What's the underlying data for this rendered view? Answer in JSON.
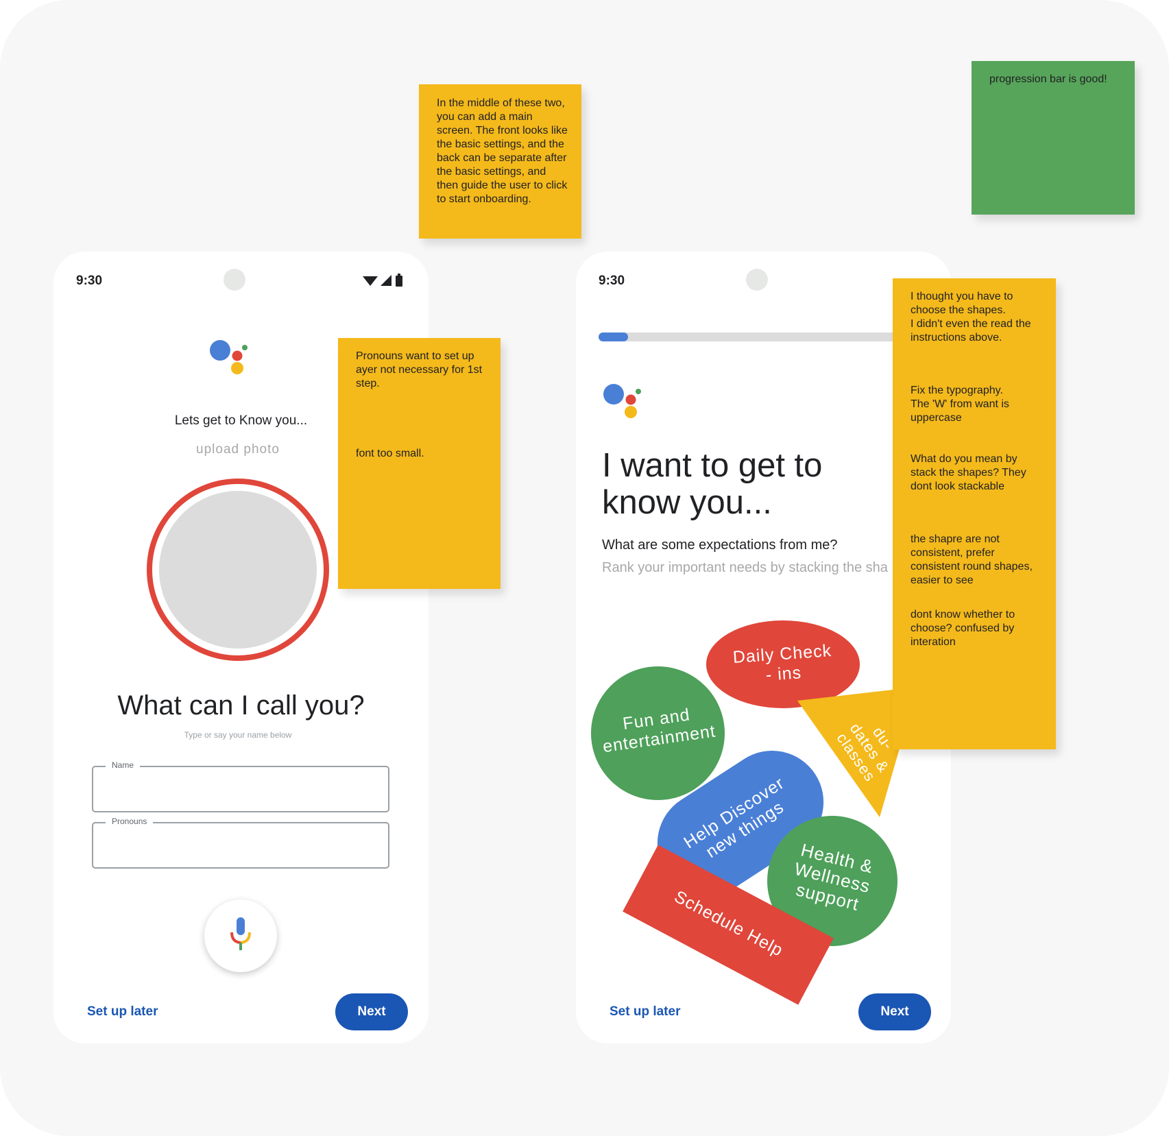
{
  "left_screen": {
    "status_time": "9:30",
    "greeting": "Lets get to Know you...",
    "upload_photo": "upload photo",
    "title": "What can I call you?",
    "hint": "Type or say your name below",
    "name_field_label": "Name",
    "name_field_value": "",
    "pronouns_field_label": "Pronouns",
    "pronouns_field_value": "",
    "setup_later": "Set up later",
    "next": "Next"
  },
  "right_screen": {
    "status_time": "9:30",
    "progress": 0.09,
    "title_line1": "I want to get to",
    "title_line2": "know you...",
    "subtitle": "What are some expectations from me?",
    "instructions": "Rank your important needs by stacking the sha",
    "shapes": {
      "daily_check_ins": "Daily Check\n- ins",
      "fun": "Fun and\nentertainment",
      "due_dates": "du-\ndates &\nclasses",
      "help_discover": "Help Discover\nnew things",
      "health": "Health &\nWellness\nsupport",
      "schedule": "Schedule Help"
    },
    "setup_later": "Set up later",
    "next": "Next"
  },
  "sticky_notes": {
    "middle_top": "In the middle of these two, you can add a main screen. The front looks like the basic settings, and the back can be separate after the basic settings, and then guide the user to click to start onboarding.",
    "progression": "progression bar is good!",
    "pronouns_1": "Pronouns want to set up ayer not necessary for 1st step.",
    "pronouns_2": "font too small.",
    "right_1": "I thought you have to choose the shapes.\nI didn't even the read the instructions above.",
    "right_2": "Fix the typography.\nThe 'W' from want is uppercase",
    "right_3": "What do you mean by stack the shapes? They dont look stackable",
    "right_4": "the shapre are not consistent, prefer consistent round shapes, easier to see",
    "right_5": "dont know whether to choose? confused by interation"
  },
  "colors": {
    "google_blue": "#4a7fd6",
    "google_red": "#e0463a",
    "google_yellow": "#f4b91b",
    "google_green": "#4ea05a",
    "button_blue": "#1a56b4",
    "sticky_yellow": "#f4b91b",
    "sticky_green": "#57a55a"
  },
  "icons": [
    "assistant-logo-icon",
    "wifi-icon",
    "signal-icon",
    "battery-icon",
    "microphone-icon"
  ]
}
